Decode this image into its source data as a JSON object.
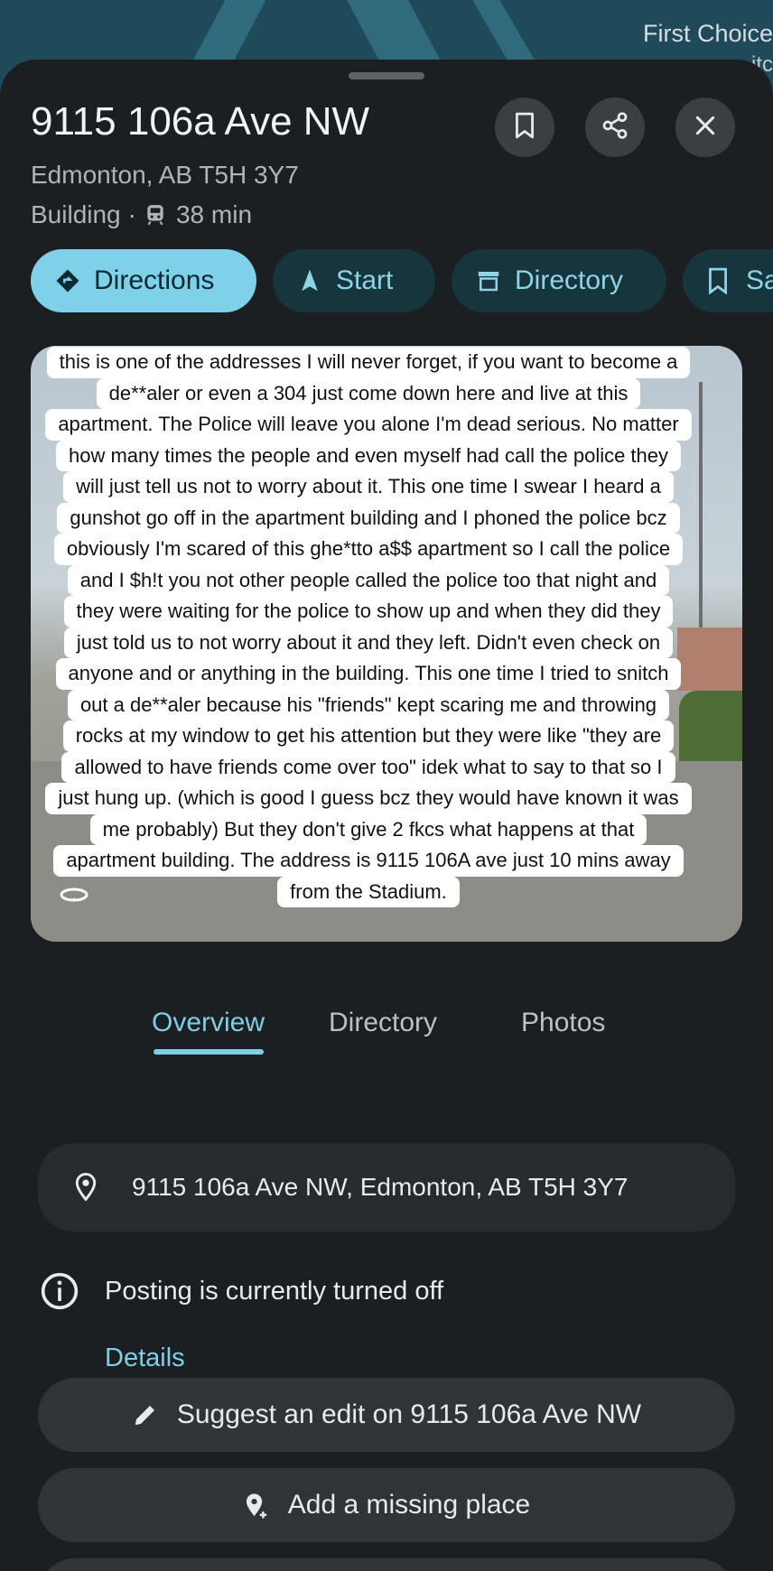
{
  "map": {
    "label_1": "First Choice",
    "label_2": "itc"
  },
  "place": {
    "title": "9115 106a Ave NW",
    "city_line": "Edmonton, AB T5H 3Y7",
    "type": "Building",
    "separator": "·",
    "transit_time": "38 min"
  },
  "header_buttons": {
    "save": "bookmark-icon",
    "share": "share-icon",
    "close": "close-icon"
  },
  "chips": [
    {
      "label": "Directions",
      "icon": "directions-icon"
    },
    {
      "label": "Start",
      "icon": "navigation-arrow-icon"
    },
    {
      "label": "Directory",
      "icon": "directory-icon"
    },
    {
      "label": "Sa",
      "icon": "bookmark-icon"
    }
  ],
  "caption_lines": [
    "this is one of the addresses I will never forget, if you want to become a",
    "de**aler or even a 304  just come down here and live at this",
    "apartment. The Police will leave you alone I'm dead serious. No matter",
    "how many times the people and even myself had call the police they",
    "will just tell us not to worry about it. This one time I swear I heard a",
    "gunshot go off in the apartment building and I phoned the police bcz",
    "obviously I'm scared of this ghe*tto a$$ apartment so I call the police",
    "and I $h!t you not other people called the police too that night and",
    "they were waiting for the police to show up and when they did they",
    "just told us to not worry about it and they left. Didn't even check on",
    "anyone and or anything in the building. This one time I tried to snitch",
    "out a de**aler because his \"friends\" kept scaring me and throwing",
    "rocks at my window to get his attention but they were like \"they are",
    "allowed to have friends come over too\" idek what to say to that so I",
    "just hung up. (which is good I guess bcz they would have known it was",
    "me probably) But they don't give 2 fkcs what happens at that",
    "apartment building. The address is 9115 106A ave just 10 mins away",
    "from the Stadium."
  ],
  "tabs": [
    {
      "label": "Overview",
      "active": true
    },
    {
      "label": "Directory",
      "active": false
    },
    {
      "label": "Photos",
      "active": false
    }
  ],
  "address_row": {
    "icon": "location-pin-icon",
    "text": "9115 106a Ave NW, Edmonton, AB T5H 3Y7"
  },
  "posting": {
    "icon": "info-icon",
    "text": "Posting is currently turned off",
    "details_label": "Details"
  },
  "actions": {
    "suggest_edit": "Suggest an edit on 9115 106a Ave NW",
    "add_missing_place": "Add a missing place"
  },
  "colors": {
    "accent": "#7ecfe6",
    "sheet": "#1b1f22",
    "chip_bg": "#16353c"
  }
}
